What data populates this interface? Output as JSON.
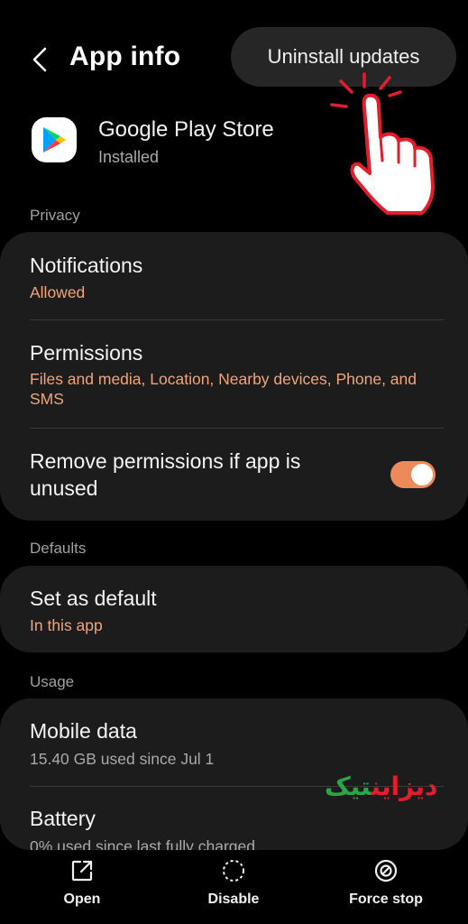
{
  "header": {
    "title": "App info",
    "uninstall_label": "Uninstall updates"
  },
  "app": {
    "name": "Google Play Store",
    "status": "Installed"
  },
  "sections": {
    "privacy": "Privacy",
    "defaults": "Defaults",
    "usage": "Usage"
  },
  "privacy": {
    "notifications": {
      "title": "Notifications",
      "sub": "Allowed"
    },
    "permissions": {
      "title": "Permissions",
      "sub": "Files and media, Location, Nearby devices, Phone, and SMS"
    },
    "remove_unused": {
      "line1": "Remove permissions if app is",
      "line2": "unused",
      "enabled": true
    }
  },
  "defaults": {
    "set_default": {
      "title": "Set as default",
      "sub": "In this app"
    }
  },
  "usage": {
    "mobile_data": {
      "title": "Mobile data",
      "sub": "15.40 GB used since Jul 1"
    },
    "battery": {
      "title": "Battery",
      "sub": "0% used since last fully charged"
    }
  },
  "bottom": {
    "open": "Open",
    "disable": "Disable",
    "force_stop": "Force stop"
  },
  "watermark": {
    "part1": "دیزاین",
    "part2": "تیک"
  },
  "colors": {
    "accent": "#ec8a5a",
    "subtext": "#f0a57a",
    "card": "#1c1c1c",
    "background": "#000000"
  },
  "icons": [
    "back-arrow-icon",
    "play-store-icon",
    "open-icon",
    "disable-icon",
    "force-stop-icon",
    "pointing-hand-icon"
  ]
}
